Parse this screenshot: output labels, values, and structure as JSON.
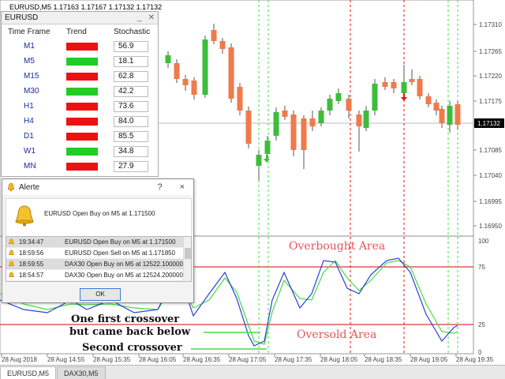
{
  "window": {
    "title": "EURUSD,M5",
    "quote": "1.17163 1.17167 1.17132 1.17132"
  },
  "price_axis": {
    "labels": [
      "1.17310",
      "1.17265",
      "1.17220",
      "1.17175",
      "1.17130",
      "1.17085",
      "1.17040",
      "1.16995",
      "1.16950"
    ],
    "current": "1.17132"
  },
  "stoch_axis": {
    "labels": [
      "100",
      "75",
      "25",
      "0"
    ]
  },
  "time_axis": {
    "labels": [
      "28 Aug 2018",
      "28 Aug 14:55",
      "28 Aug 15:35",
      "28 Aug 16:05",
      "28 Aug 16:35",
      "28 Aug 17:05",
      "28 Aug 17:35",
      "28 Aug 18:05",
      "28 Aug 18:35",
      "28 Aug 19:05",
      "28 Aug 19:35"
    ]
  },
  "annotations": {
    "overbought": "Overbought Area",
    "oversold": "Oversold Area",
    "first_line1": "One first crossover",
    "first_line2": "but came back below",
    "second": "Second crossover"
  },
  "trend_panel": {
    "title": "EURUSD",
    "col_timeframe": "Time Frame",
    "col_trend": "Trend",
    "col_stochastic": "Stochastic",
    "rows": [
      {
        "tf": "M1",
        "trend": "down",
        "value": "56.9"
      },
      {
        "tf": "M5",
        "trend": "up",
        "value": "18.1"
      },
      {
        "tf": "M15",
        "trend": "down",
        "value": "62.8"
      },
      {
        "tf": "M30",
        "trend": "up",
        "value": "42.2"
      },
      {
        "tf": "H1",
        "trend": "down",
        "value": "73.6"
      },
      {
        "tf": "H4",
        "trend": "down",
        "value": "84.0"
      },
      {
        "tf": "D1",
        "trend": "down",
        "value": "85.5"
      },
      {
        "tf": "W1",
        "trend": "up",
        "value": "34.8"
      },
      {
        "tf": "MN",
        "trend": "down",
        "value": "27.9"
      }
    ]
  },
  "alert": {
    "title": "Alerte",
    "help": "?",
    "close": "×",
    "message": "EURUSD Open Buy on M5 at 1.171500",
    "items": [
      {
        "time": "19:34:47",
        "msg": "EURUSD Open Buy on M5 at 1.171500",
        "selected": true
      },
      {
        "time": "18:59:56",
        "msg": "EURUSD Open Sell on M5 at 1.171850",
        "selected": false
      },
      {
        "time": "18:59:55",
        "msg": "DAX30 Open Buy on M5 at 12522.100000",
        "selected": true
      },
      {
        "time": "18:54:57",
        "msg": "DAX30 Open Buy on M5 at 12524.200000",
        "selected": false
      }
    ],
    "ok": "OK"
  },
  "tabs": [
    "EURUSD,M5",
    "DAX30,M5"
  ],
  "colors": {
    "up": "#22cc22",
    "down": "#ee1111",
    "bull_candle": "#3cbd3c",
    "bear_candle": "#f07a4a",
    "stoch_main": "#2a3fd8",
    "stoch_signal": "#44dd44",
    "level": "#e8555a"
  }
}
